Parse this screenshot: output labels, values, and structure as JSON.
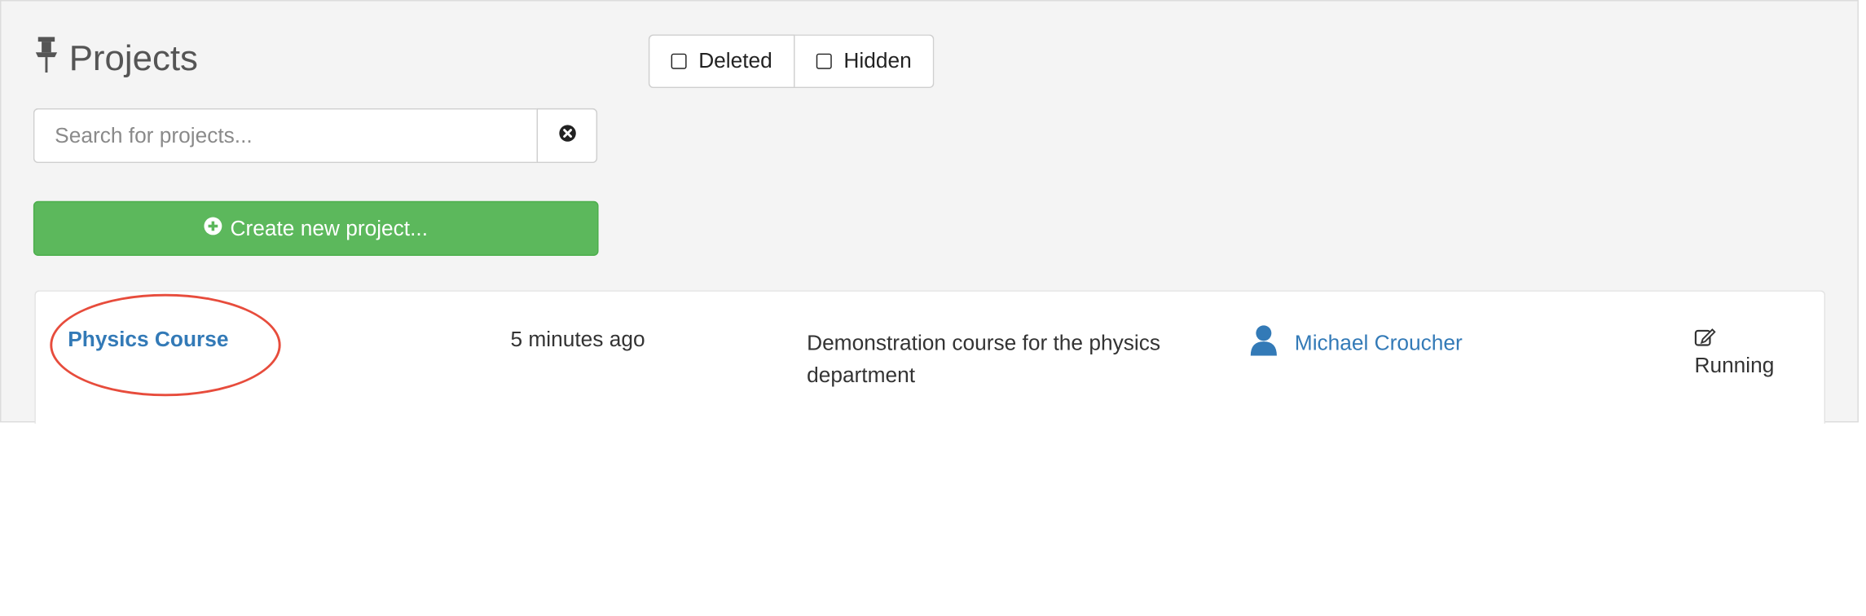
{
  "header": {
    "title": "Projects",
    "icon": "pushpin-icon"
  },
  "filters": {
    "deleted_label": "Deleted",
    "hidden_label": "Hidden"
  },
  "search": {
    "placeholder": "Search for projects...",
    "value": ""
  },
  "actions": {
    "create_label": "Create new project..."
  },
  "projects": [
    {
      "name": "Physics Course",
      "modified": "5 minutes ago",
      "description": "Demonstration course for the physics department",
      "user": "Michael Croucher",
      "state": "Running"
    }
  ],
  "colors": {
    "accent": "#337ab7",
    "create_button": "#5cb85c",
    "highlight": "#e74c3c"
  }
}
